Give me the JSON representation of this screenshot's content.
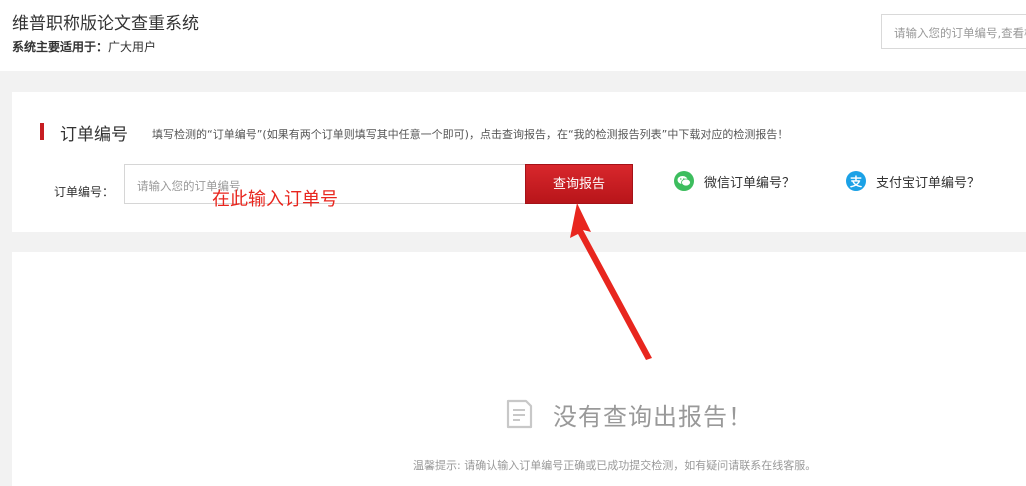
{
  "header": {
    "title": "维普职称版论文查重系统",
    "subtitle_label": "系统主要适用于：",
    "subtitle_value": "广大用户",
    "search_placeholder": "请输入您的订单编号,查看检测报告"
  },
  "panel": {
    "title": "订单编号",
    "description": "填写检测的“订单编号”(如果有两个订单则填写其中任意一个即可)，点击查询报告，在“我的检测报告列表”中下载对应的检测报告！",
    "order_label": "订单编号：",
    "order_placeholder": "请输入您的订单编号",
    "query_button": "查询报告",
    "wechat_link": "微信订单编号？",
    "alipay_link": "支付宝订单编号？",
    "alipay_glyph": "支"
  },
  "annotation": {
    "text": "在此输入订单号",
    "color": "#e8261e"
  },
  "result": {
    "empty_text": "没有查询出报告！",
    "tip": "温馨提示: 请确认输入订单编号正确或已成功提交检测，如有疑问请联系在线客服。"
  },
  "colors": {
    "accent": "#c71d22",
    "wechat": "#3dbd5e",
    "alipay": "#1ba1e6"
  },
  "icons": {
    "wechat": "wechat-icon",
    "alipay": "alipay-icon",
    "empty": "document-icon"
  }
}
